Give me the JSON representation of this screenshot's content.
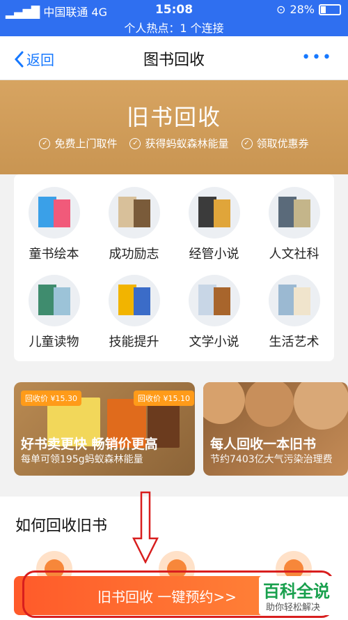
{
  "status_bar": {
    "carrier": "中国联通",
    "network": "4G",
    "time": "15:08",
    "battery": "28%",
    "battery_level": 0.28,
    "hotspot": "个人热点：1 个连接"
  },
  "nav": {
    "back_label": "返回",
    "title": "图书回收",
    "more": "•••"
  },
  "banner": {
    "title": "旧书回收",
    "features": [
      "免费上门取件",
      "获得蚂蚁森林能量",
      "领取优惠券"
    ]
  },
  "categories": [
    {
      "label": "童书绘本",
      "colors": [
        "#3aa0e8",
        "#f15a7a"
      ]
    },
    {
      "label": "成功励志",
      "colors": [
        "#d8c09a",
        "#7a5b3a"
      ]
    },
    {
      "label": "经管小说",
      "colors": [
        "#3b3b3b",
        "#e0a53a"
      ]
    },
    {
      "label": "人文社科",
      "colors": [
        "#5a6a7a",
        "#c4b58a"
      ]
    },
    {
      "label": "儿童读物",
      "colors": [
        "#3f8c6e",
        "#9cc3d8"
      ]
    },
    {
      "label": "技能提升",
      "colors": [
        "#f2b400",
        "#3b6cc8"
      ]
    },
    {
      "label": "文学小说",
      "colors": [
        "#c8d6e6",
        "#a8652c"
      ]
    },
    {
      "label": "生活艺术",
      "colors": [
        "#9bb9d2",
        "#f0e4cc"
      ]
    }
  ],
  "promos": [
    {
      "tags": [
        "回收价 ¥15.30",
        "回收价 ¥15.10"
      ],
      "title": "好书卖更快 畅销价更高",
      "subtitle": "每单可领195g蚂蚁森林能量"
    },
    {
      "title": "每人回收一本旧书",
      "subtitle": "节约7403亿大气污染治理费"
    }
  ],
  "how": {
    "title": "如何回收旧书"
  },
  "cta": {
    "label": "旧书回收 一键预约>>"
  },
  "watermark": {
    "big": "百科全说",
    "small": "助你轻松解决"
  },
  "colors": {
    "accent": "#2f6ff0",
    "link": "#1678ff",
    "banner": "#cf9b5a",
    "cta": "#ff6a2f",
    "highlight": "#d81e1e"
  }
}
